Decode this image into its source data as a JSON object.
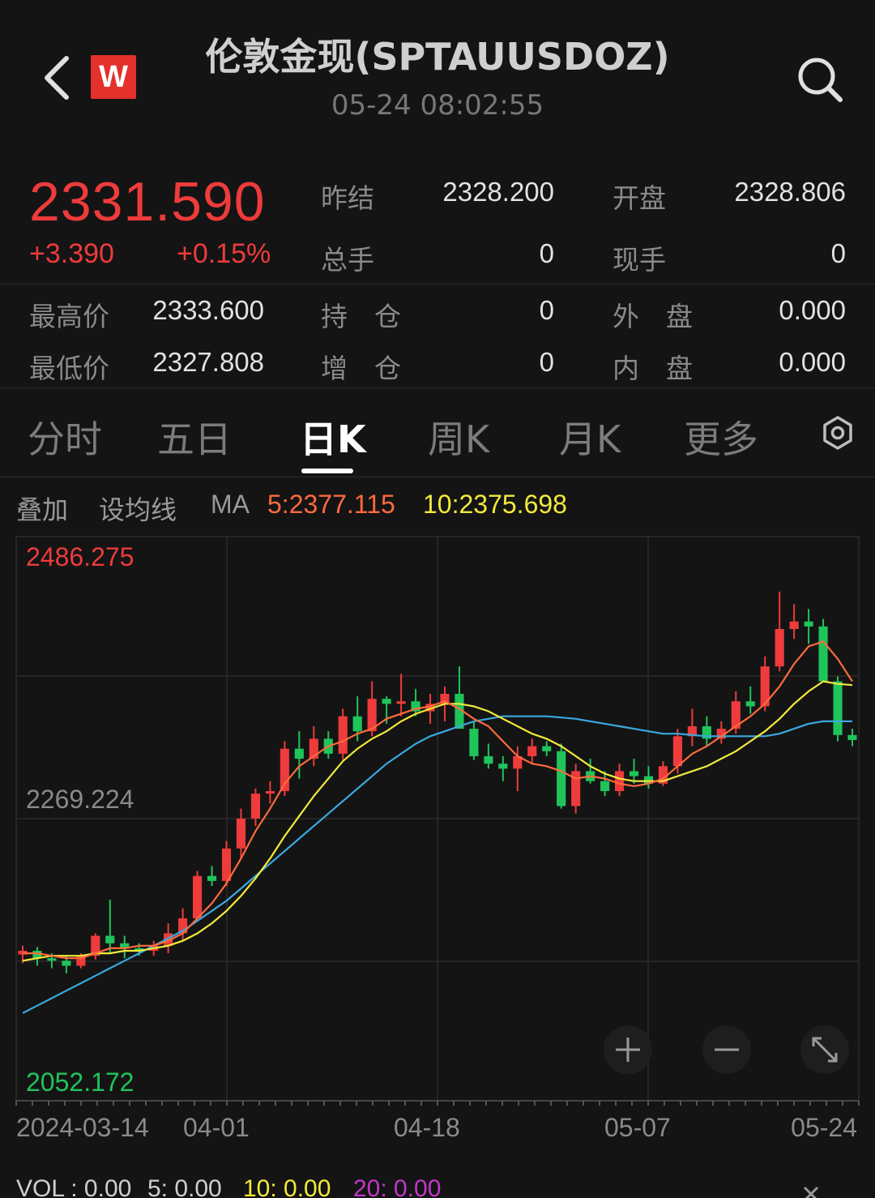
{
  "header": {
    "title": "伦敦金现(SPTAUUSDOZ)",
    "time": "05-24 08:02:55",
    "logo_letter": "W",
    "icons": [
      "back-arrow-icon",
      "search-icon",
      "settings-gear-icon",
      "zoom-in-icon",
      "zoom-out-icon",
      "expand-icon",
      "close-icon"
    ]
  },
  "quote": {
    "price": "2331.590",
    "change": "+3.390",
    "change_pct": "+0.15%",
    "prev_settle_label": "昨结",
    "prev_settle": "2328.200",
    "open_label": "开盘",
    "open": "2328.806",
    "total_vol_label": "总手",
    "total_vol": "0",
    "cur_vol_label": "现手",
    "cur_vol": "0",
    "high_label": "最高价",
    "high": "2333.600",
    "position_label": "持　仓",
    "position": "0",
    "outer_label": "外　盘",
    "outer": "0.000",
    "low_label": "最低价",
    "low": "2327.808",
    "add_pos_label": "增　仓",
    "add_pos": "0",
    "inner_label": "内　盘",
    "inner": "0.000"
  },
  "tabs": [
    {
      "label": "分时",
      "active": false
    },
    {
      "label": "五日",
      "active": false
    },
    {
      "label": "日K",
      "active": true
    },
    {
      "label": "周K",
      "active": false
    },
    {
      "label": "月K",
      "active": false
    },
    {
      "label": "更多",
      "active": false
    }
  ],
  "ma": {
    "overlay": "叠加",
    "set_ma": "设均线",
    "ma_label": "MA",
    "ma5": "5:2377.115",
    "ma10": "10:2375.698"
  },
  "colors": {
    "up": "#ee3b3b",
    "down": "#1fc45b",
    "ma5": "#ff6a3d",
    "ma10": "#f2ea3a",
    "ma20": "#39a9e0",
    "vol20": "#c038c8"
  },
  "chart_data": {
    "type": "candlestick",
    "y_top_label": "2486.275",
    "y_mid_label": "2269.224",
    "y_bottom_label": "2052.172",
    "ylim": [
      2052.172,
      2486.275
    ],
    "x_labels": [
      "2024-03-14",
      "04-01",
      "04-18",
      "05-07",
      "05-24"
    ],
    "candles": [
      [
        2159,
        2166,
        2152,
        2162
      ],
      [
        2162,
        2165,
        2150,
        2156
      ],
      [
        2156,
        2160,
        2148,
        2154
      ],
      [
        2154,
        2158,
        2144,
        2150
      ],
      [
        2150,
        2160,
        2148,
        2158
      ],
      [
        2158,
        2176,
        2155,
        2174
      ],
      [
        2174,
        2203,
        2160,
        2168
      ],
      [
        2168,
        2174,
        2156,
        2164
      ],
      [
        2164,
        2168,
        2158,
        2162
      ],
      [
        2162,
        2170,
        2158,
        2166
      ],
      [
        2166,
        2184,
        2160,
        2176
      ],
      [
        2176,
        2196,
        2170,
        2188
      ],
      [
        2188,
        2226,
        2186,
        2222
      ],
      [
        2222,
        2230,
        2214,
        2218
      ],
      [
        2218,
        2250,
        2214,
        2244
      ],
      [
        2244,
        2276,
        2236,
        2268
      ],
      [
        2268,
        2292,
        2262,
        2288
      ],
      [
        2288,
        2298,
        2280,
        2290
      ],
      [
        2290,
        2330,
        2286,
        2324
      ],
      [
        2324,
        2338,
        2300,
        2316
      ],
      [
        2316,
        2342,
        2310,
        2332
      ],
      [
        2332,
        2338,
        2316,
        2320
      ],
      [
        2320,
        2356,
        2315,
        2350
      ],
      [
        2350,
        2366,
        2330,
        2338
      ],
      [
        2338,
        2378,
        2334,
        2364
      ],
      [
        2364,
        2366,
        2344,
        2360
      ],
      [
        2360,
        2384,
        2350,
        2362
      ],
      [
        2362,
        2372,
        2350,
        2354
      ],
      [
        2354,
        2368,
        2344,
        2360
      ],
      [
        2360,
        2374,
        2346,
        2368
      ],
      [
        2368,
        2390,
        2350,
        2340
      ],
      [
        2340,
        2346,
        2315,
        2318
      ],
      [
        2318,
        2328,
        2308,
        2312
      ],
      [
        2312,
        2318,
        2298,
        2308
      ],
      [
        2308,
        2326,
        2290,
        2318
      ],
      [
        2318,
        2332,
        2312,
        2326
      ],
      [
        2326,
        2330,
        2318,
        2322
      ],
      [
        2322,
        2328,
        2276,
        2278
      ],
      [
        2278,
        2312,
        2272,
        2306
      ],
      [
        2306,
        2316,
        2296,
        2298
      ],
      [
        2298,
        2306,
        2286,
        2290
      ],
      [
        2290,
        2312,
        2286,
        2306
      ],
      [
        2306,
        2316,
        2296,
        2302
      ],
      [
        2302,
        2310,
        2292,
        2296
      ],
      [
        2296,
        2314,
        2294,
        2310
      ],
      [
        2310,
        2340,
        2304,
        2334
      ],
      [
        2334,
        2356,
        2326,
        2342
      ],
      [
        2342,
        2350,
        2326,
        2332
      ],
      [
        2332,
        2346,
        2328,
        2340
      ],
      [
        2340,
        2370,
        2336,
        2362
      ],
      [
        2362,
        2374,
        2352,
        2358
      ],
      [
        2358,
        2398,
        2354,
        2390
      ],
      [
        2390,
        2450,
        2386,
        2420
      ],
      [
        2420,
        2440,
        2412,
        2426
      ],
      [
        2426,
        2436,
        2408,
        2422
      ],
      [
        2422,
        2428,
        2378,
        2378
      ],
      [
        2378,
        2382,
        2330,
        2335
      ],
      [
        2335,
        2340,
        2326,
        2331
      ]
    ],
    "ma5": [
      2160,
      2160,
      2158,
      2156,
      2156,
      2160,
      2164,
      2164,
      2166,
      2166,
      2170,
      2176,
      2188,
      2200,
      2216,
      2236,
      2258,
      2276,
      2296,
      2310,
      2318,
      2326,
      2330,
      2336,
      2340,
      2348,
      2352,
      2356,
      2358,
      2362,
      2356,
      2348,
      2342,
      2330,
      2318,
      2312,
      2310,
      2306,
      2300,
      2302,
      2300,
      2296,
      2294,
      2296,
      2300,
      2310,
      2320,
      2326,
      2334,
      2342,
      2350,
      2360,
      2374,
      2392,
      2406,
      2410,
      2396,
      2378
    ],
    "ma10": [
      2154,
      2156,
      2158,
      2158,
      2158,
      2160,
      2160,
      2162,
      2162,
      2164,
      2166,
      2170,
      2176,
      2184,
      2194,
      2206,
      2220,
      2236,
      2254,
      2270,
      2286,
      2300,
      2314,
      2324,
      2332,
      2338,
      2346,
      2352,
      2356,
      2360,
      2360,
      2358,
      2354,
      2348,
      2342,
      2336,
      2332,
      2326,
      2318,
      2310,
      2304,
      2300,
      2298,
      2298,
      2298,
      2302,
      2306,
      2310,
      2316,
      2322,
      2330,
      2338,
      2348,
      2360,
      2370,
      2378,
      2376,
      2375
    ],
    "ma20": [
      2112,
      2118,
      2124,
      2130,
      2136,
      2142,
      2148,
      2154,
      2160,
      2166,
      2172,
      2178,
      2186,
      2194,
      2202,
      2212,
      2222,
      2232,
      2242,
      2252,
      2262,
      2272,
      2282,
      2292,
      2302,
      2312,
      2320,
      2328,
      2334,
      2338,
      2342,
      2346,
      2348,
      2350,
      2350,
      2350,
      2350,
      2349,
      2348,
      2346,
      2344,
      2342,
      2340,
      2338,
      2336,
      2336,
      2335,
      2334,
      2334,
      2334,
      2334,
      2334,
      2336,
      2340,
      2344,
      2346,
      2346,
      2346
    ]
  },
  "controls": {
    "zoom_in": "+",
    "zoom_out": "−"
  },
  "volume": {
    "vol": "VOL : 0.00",
    "v5": "5: 0.00",
    "v10": "10: 0.00",
    "v20": "20: 0.00"
  }
}
